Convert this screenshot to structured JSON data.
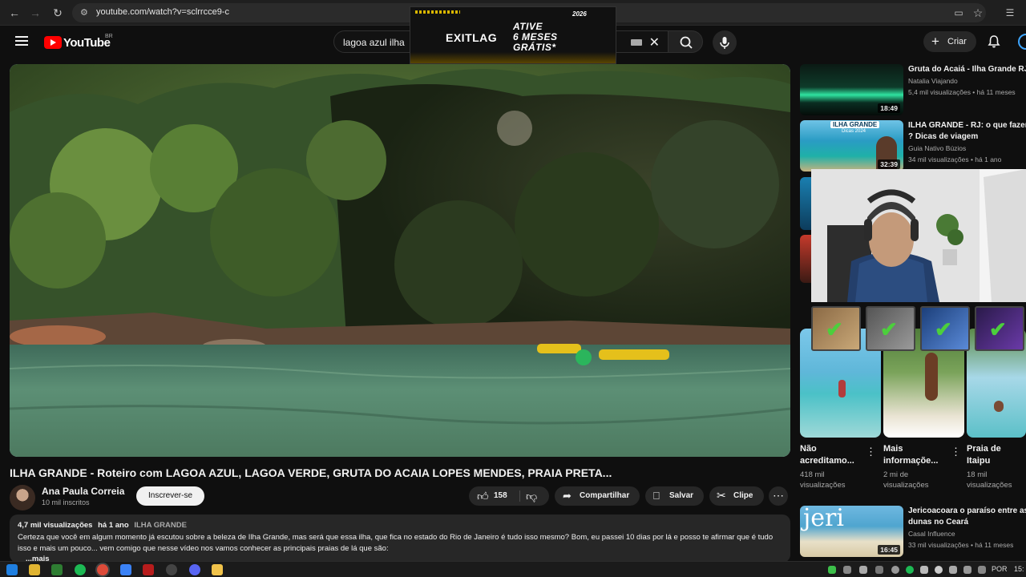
{
  "browser": {
    "url": "youtube.com/watch?v=sclrrcce9-c"
  },
  "header": {
    "logo_text": "YouTube",
    "country": "BR",
    "search_value": "lagoa azul ilha",
    "create_label": "Criar"
  },
  "ad": {
    "brand": "EXITLAG",
    "line1": "ATIVE",
    "line2": "6 MESES",
    "line3": "GRÁTIS*",
    "year": "2026"
  },
  "video": {
    "title": "ILHA GRANDE - Roteiro com LAGOA AZUL, LAGOA VERDE, GRUTA DO ACAIA LOPES MENDES, PRAIA PRETA...",
    "channel_name": "Ana Paula Correia",
    "subscribers": "10 mil inscritos",
    "subscribe_label": "Inscrever-se",
    "likes": "158",
    "share_label": "Compartilhar",
    "save_label": "Salvar",
    "clip_label": "Clipe"
  },
  "description": {
    "views": "4,7 mil visualizações",
    "age": "há 1 ano",
    "tag": "ILHA GRANDE",
    "text": "Certeza que você em algum momento já escutou sobre a beleza de Ilha Grande, mas será que essa ilha, que fica no estado do Rio de Janeiro é tudo isso mesmo? Bom, eu passei 10 dias por lá e posso te afirmar que é tudo isso e mais um pouco... vem comigo que nesse vídeo nos vamos conhecer as principais praias de lá que são:",
    "more": "...mais"
  },
  "sidebar": {
    "items": [
      {
        "title": "Gruta do Acaiá - Ilha Grande RJ",
        "channel": "Natalia Viajando",
        "views": "5,4 mil visualizações • há 11 meses",
        "duration": "18:49"
      },
      {
        "title": "ILHA GRANDE - RJ: o que fazer",
        "title2": "? Dicas de viagem",
        "channel": "Guia Nativo Búzios",
        "views": "34 mil visualizações • há 1 ano",
        "duration": "32:39",
        "thumb_label": "ILHA GRANDE",
        "thumb_sub": "Dicas 2024"
      },
      {
        "title": "Jericoacoara o paraíso  entre as",
        "title2": "dunas no Ceará",
        "channel": "Casal Influence",
        "views": "33 mil visualizações • há 11 meses",
        "duration": "16:45",
        "thumb_label": "jeri"
      }
    ]
  },
  "shorts": [
    {
      "title1": "Não",
      "title2": "acreditamo...",
      "views1": "418 mil",
      "views2": "visualizações"
    },
    {
      "title1": "Mais",
      "title2": "informaçõe...",
      "views1": "2 mi de",
      "views2": "visualizações"
    },
    {
      "title1": "Praia de",
      "title2": "Itaipu",
      "views1": "18 mil",
      "views2": "visualizações"
    }
  ],
  "taskbar": {
    "lang": "POR",
    "clock": "15:"
  },
  "colors": {
    "accent_red": "#ff0000",
    "background": "#0f0f0f",
    "pill": "#272727",
    "check_green": "#4ccf3c"
  }
}
